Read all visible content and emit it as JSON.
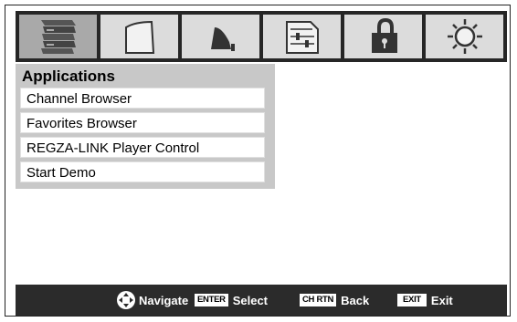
{
  "tabs": [
    {
      "icon": "applications-icon",
      "active": true
    },
    {
      "icon": "picture-icon",
      "active": false
    },
    {
      "icon": "sound-icon",
      "active": false
    },
    {
      "icon": "setup-icon",
      "active": false
    },
    {
      "icon": "lock-icon",
      "active": false
    },
    {
      "icon": "options-icon",
      "active": false
    }
  ],
  "panel": {
    "title": "Applications",
    "items": [
      {
        "label": "Channel Browser"
      },
      {
        "label": "Favorites Browser"
      },
      {
        "label": "REGZA-LINK Player Control"
      },
      {
        "label": "Start Demo"
      }
    ]
  },
  "helpbar": {
    "navigate": {
      "label": "Navigate"
    },
    "select": {
      "key": "ENTER",
      "label": "Select"
    },
    "back": {
      "key": "CH RTN",
      "label": "Back"
    },
    "exit": {
      "key": "EXIT",
      "label": "Exit"
    }
  }
}
